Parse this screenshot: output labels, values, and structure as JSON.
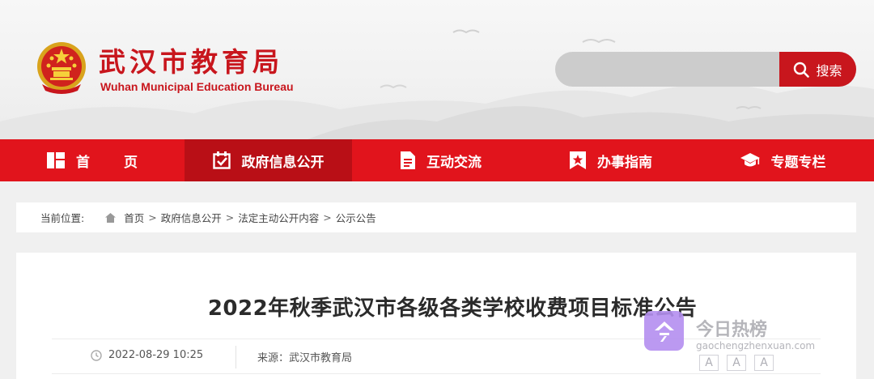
{
  "header": {
    "title": "武汉市教育局",
    "subtitle": "Wuhan Municipal Education Bureau",
    "search": {
      "placeholder": "",
      "button_label": "搜索"
    }
  },
  "nav": {
    "items": [
      {
        "label": "首页",
        "icon": "grid-icon"
      },
      {
        "label": "政府信息公开",
        "icon": "checkbox-icon",
        "active": true
      },
      {
        "label": "互动交流",
        "icon": "document-icon"
      },
      {
        "label": "办事指南",
        "icon": "bookmark-star-icon"
      },
      {
        "label": "专题专栏",
        "icon": "graduation-cap-icon"
      }
    ]
  },
  "breadcrumb": {
    "label": "当前位置:",
    "items": [
      "首页",
      "政府信息公开",
      "法定主动公开内容",
      "公示公告"
    ],
    "separator": ">"
  },
  "article": {
    "title": "2022年秋季武汉市各级各类学校收费项目标准公告",
    "date": "2022-08-29 10:25",
    "source": "来源：武汉市教育局"
  },
  "watermark": {
    "name": "今日热榜",
    "url": "gaochengzhenxuan.com",
    "font_buttons": [
      "A",
      "A",
      "A"
    ]
  },
  "colors": {
    "brand_red": "#c8161d",
    "nav_red": "#e1141c",
    "nav_active": "#b90f16"
  }
}
